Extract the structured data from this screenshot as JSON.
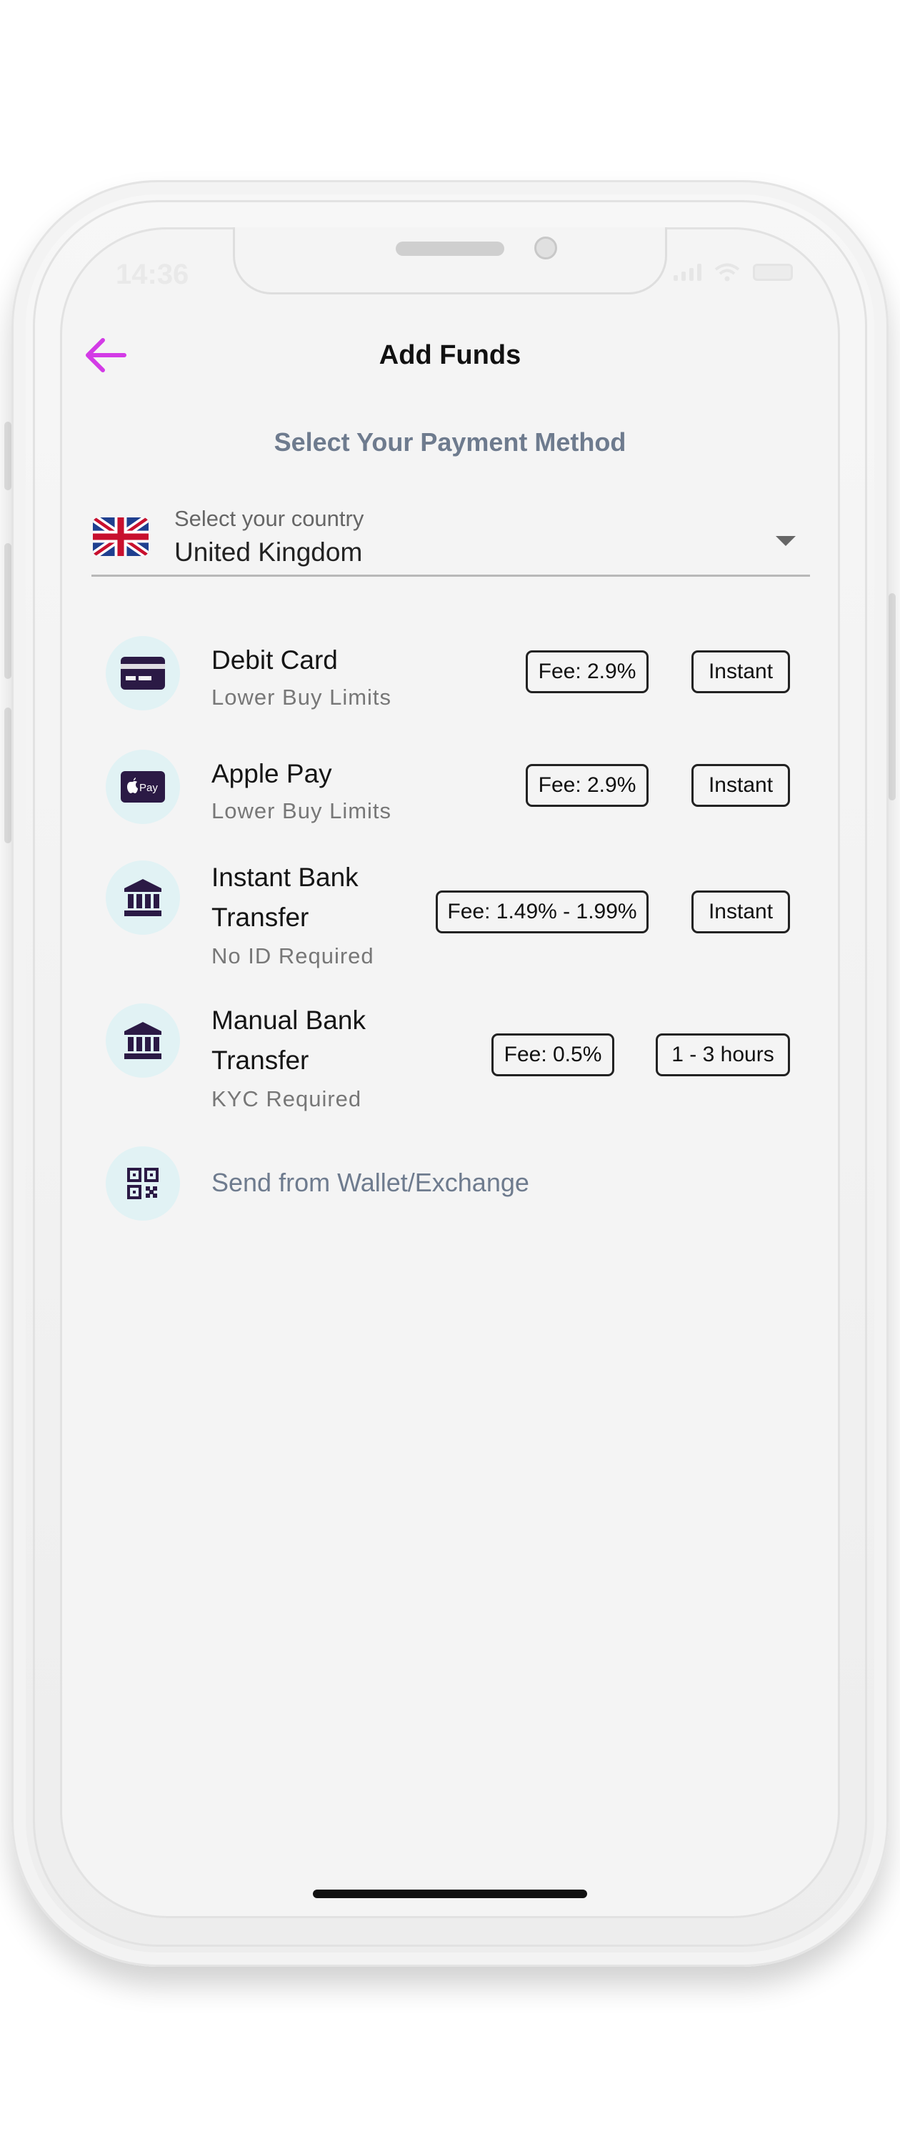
{
  "status_bar": {
    "time": "14:36"
  },
  "header": {
    "title": "Add Funds"
  },
  "subtitle": "Select Your Payment Method",
  "country": {
    "label": "Select your country",
    "value": "United Kingdom"
  },
  "methods": [
    {
      "title": "Debit Card",
      "subtitle": "Lower Buy Limits",
      "fee": "Fee: 2.9%",
      "speed": "Instant",
      "icon": "credit-card-icon"
    },
    {
      "title": "Apple Pay",
      "subtitle": "Lower Buy Limits",
      "fee": "Fee: 2.9%",
      "speed": "Instant",
      "icon": "apple-pay-icon",
      "icon_text": "Pay"
    },
    {
      "title_line1": "Instant Bank",
      "title_line2": "Transfer",
      "subtitle": "No ID Required",
      "fee": "Fee: 1.49% - 1.99%",
      "speed": "Instant",
      "icon": "bank-icon"
    },
    {
      "title_line1": "Manual Bank",
      "title_line2": "Transfer",
      "subtitle": "KYC Required",
      "fee": "Fee: 0.5%",
      "speed": "1 - 3 hours",
      "icon": "bank-icon"
    }
  ],
  "wallet": {
    "label": "Send from Wallet/Exchange",
    "icon": "qr-code-icon"
  },
  "colors": {
    "accent": "#d33be6",
    "icon_dark": "#2b1a45",
    "icon_bg": "#e1f2f4",
    "muted_text": "#6e7b8e"
  }
}
